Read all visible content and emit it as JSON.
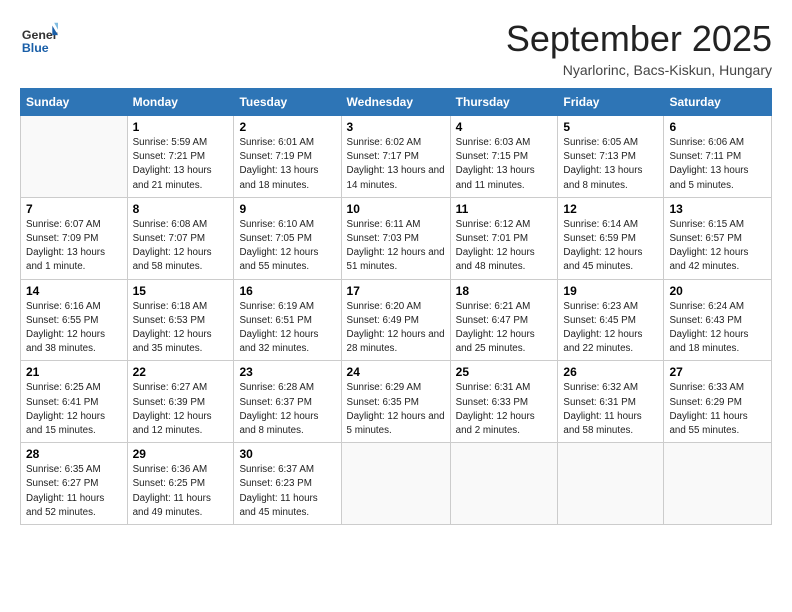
{
  "logo": {
    "general": "General",
    "blue": "Blue"
  },
  "title": "September 2025",
  "subtitle": "Nyarlorinc, Bacs-Kiskun, Hungary",
  "days_header": [
    "Sunday",
    "Monday",
    "Tuesday",
    "Wednesday",
    "Thursday",
    "Friday",
    "Saturday"
  ],
  "weeks": [
    [
      {
        "day": "",
        "info": ""
      },
      {
        "day": "1",
        "info": "Sunrise: 5:59 AM\nSunset: 7:21 PM\nDaylight: 13 hours and 21 minutes."
      },
      {
        "day": "2",
        "info": "Sunrise: 6:01 AM\nSunset: 7:19 PM\nDaylight: 13 hours and 18 minutes."
      },
      {
        "day": "3",
        "info": "Sunrise: 6:02 AM\nSunset: 7:17 PM\nDaylight: 13 hours and 14 minutes."
      },
      {
        "day": "4",
        "info": "Sunrise: 6:03 AM\nSunset: 7:15 PM\nDaylight: 13 hours and 11 minutes."
      },
      {
        "day": "5",
        "info": "Sunrise: 6:05 AM\nSunset: 7:13 PM\nDaylight: 13 hours and 8 minutes."
      },
      {
        "day": "6",
        "info": "Sunrise: 6:06 AM\nSunset: 7:11 PM\nDaylight: 13 hours and 5 minutes."
      }
    ],
    [
      {
        "day": "7",
        "info": "Sunrise: 6:07 AM\nSunset: 7:09 PM\nDaylight: 13 hours and 1 minute."
      },
      {
        "day": "8",
        "info": "Sunrise: 6:08 AM\nSunset: 7:07 PM\nDaylight: 12 hours and 58 minutes."
      },
      {
        "day": "9",
        "info": "Sunrise: 6:10 AM\nSunset: 7:05 PM\nDaylight: 12 hours and 55 minutes."
      },
      {
        "day": "10",
        "info": "Sunrise: 6:11 AM\nSunset: 7:03 PM\nDaylight: 12 hours and 51 minutes."
      },
      {
        "day": "11",
        "info": "Sunrise: 6:12 AM\nSunset: 7:01 PM\nDaylight: 12 hours and 48 minutes."
      },
      {
        "day": "12",
        "info": "Sunrise: 6:14 AM\nSunset: 6:59 PM\nDaylight: 12 hours and 45 minutes."
      },
      {
        "day": "13",
        "info": "Sunrise: 6:15 AM\nSunset: 6:57 PM\nDaylight: 12 hours and 42 minutes."
      }
    ],
    [
      {
        "day": "14",
        "info": "Sunrise: 6:16 AM\nSunset: 6:55 PM\nDaylight: 12 hours and 38 minutes."
      },
      {
        "day": "15",
        "info": "Sunrise: 6:18 AM\nSunset: 6:53 PM\nDaylight: 12 hours and 35 minutes."
      },
      {
        "day": "16",
        "info": "Sunrise: 6:19 AM\nSunset: 6:51 PM\nDaylight: 12 hours and 32 minutes."
      },
      {
        "day": "17",
        "info": "Sunrise: 6:20 AM\nSunset: 6:49 PM\nDaylight: 12 hours and 28 minutes."
      },
      {
        "day": "18",
        "info": "Sunrise: 6:21 AM\nSunset: 6:47 PM\nDaylight: 12 hours and 25 minutes."
      },
      {
        "day": "19",
        "info": "Sunrise: 6:23 AM\nSunset: 6:45 PM\nDaylight: 12 hours and 22 minutes."
      },
      {
        "day": "20",
        "info": "Sunrise: 6:24 AM\nSunset: 6:43 PM\nDaylight: 12 hours and 18 minutes."
      }
    ],
    [
      {
        "day": "21",
        "info": "Sunrise: 6:25 AM\nSunset: 6:41 PM\nDaylight: 12 hours and 15 minutes."
      },
      {
        "day": "22",
        "info": "Sunrise: 6:27 AM\nSunset: 6:39 PM\nDaylight: 12 hours and 12 minutes."
      },
      {
        "day": "23",
        "info": "Sunrise: 6:28 AM\nSunset: 6:37 PM\nDaylight: 12 hours and 8 minutes."
      },
      {
        "day": "24",
        "info": "Sunrise: 6:29 AM\nSunset: 6:35 PM\nDaylight: 12 hours and 5 minutes."
      },
      {
        "day": "25",
        "info": "Sunrise: 6:31 AM\nSunset: 6:33 PM\nDaylight: 12 hours and 2 minutes."
      },
      {
        "day": "26",
        "info": "Sunrise: 6:32 AM\nSunset: 6:31 PM\nDaylight: 11 hours and 58 minutes."
      },
      {
        "day": "27",
        "info": "Sunrise: 6:33 AM\nSunset: 6:29 PM\nDaylight: 11 hours and 55 minutes."
      }
    ],
    [
      {
        "day": "28",
        "info": "Sunrise: 6:35 AM\nSunset: 6:27 PM\nDaylight: 11 hours and 52 minutes."
      },
      {
        "day": "29",
        "info": "Sunrise: 6:36 AM\nSunset: 6:25 PM\nDaylight: 11 hours and 49 minutes."
      },
      {
        "day": "30",
        "info": "Sunrise: 6:37 AM\nSunset: 6:23 PM\nDaylight: 11 hours and 45 minutes."
      },
      {
        "day": "",
        "info": ""
      },
      {
        "day": "",
        "info": ""
      },
      {
        "day": "",
        "info": ""
      },
      {
        "day": "",
        "info": ""
      }
    ]
  ]
}
